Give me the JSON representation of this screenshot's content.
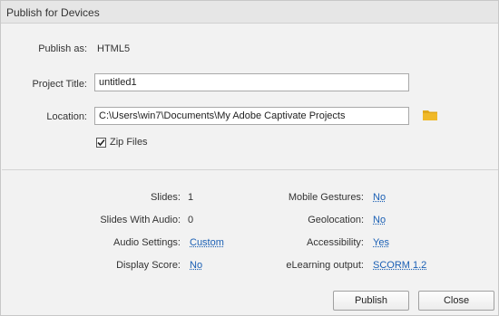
{
  "window": {
    "title": "Publish for Devices"
  },
  "publish_as": {
    "label": "Publish as:",
    "value": "HTML5"
  },
  "project_title": {
    "label": "Project Title:",
    "value": "untitled1"
  },
  "location": {
    "label": "Location:",
    "value": "C:\\Users\\win7\\Documents\\My Adobe Captivate Projects",
    "icon": "folder-icon"
  },
  "zip_files": {
    "label": "Zip Files",
    "checked": true
  },
  "summary": {
    "slides": {
      "label": "Slides:",
      "value": "1"
    },
    "slides_with_audio": {
      "label": "Slides With Audio:",
      "value": "0"
    },
    "audio_settings": {
      "label": "Audio Settings:",
      "value": "Custom"
    },
    "display_score": {
      "label": "Display Score:",
      "value": "No"
    },
    "mobile_gestures": {
      "label": "Mobile Gestures:",
      "value": "No"
    },
    "geolocation": {
      "label": "Geolocation:",
      "value": "No"
    },
    "accessibility": {
      "label": "Accessibility:",
      "value": "Yes"
    },
    "elearning_output": {
      "label": "eLearning output:",
      "value": "SCORM 1.2"
    }
  },
  "buttons": {
    "publish": "Publish",
    "close": "Close"
  },
  "colors": {
    "link": "#1a5fb4",
    "folder": "#e0a81c"
  }
}
